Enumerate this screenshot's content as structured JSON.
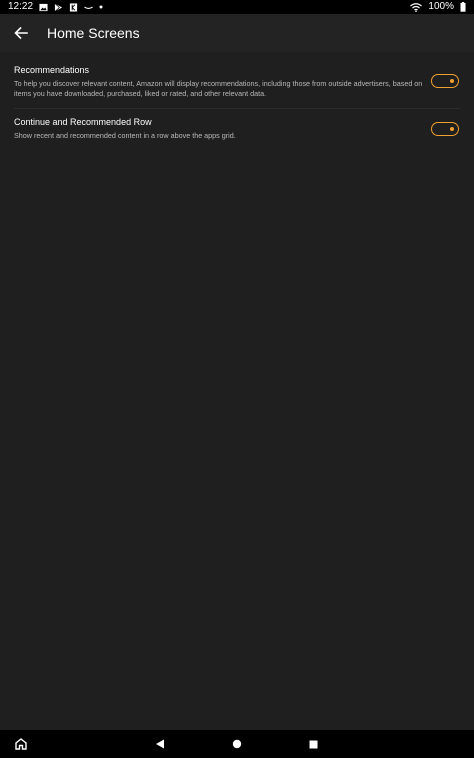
{
  "status_bar": {
    "time": "12:22",
    "battery": "100%",
    "icons_left": [
      "image-icon",
      "play-store-icon",
      "kindle-icon",
      "amazon-smile-icon",
      "dot-icon"
    ],
    "icons_right": [
      "wifi-icon",
      "battery-icon"
    ]
  },
  "app_bar": {
    "title": "Home Screens",
    "back_icon": "back-arrow-icon"
  },
  "settings": [
    {
      "title": "Recommendations",
      "description": "To help you discover relevant content, Amazon will display recommendations, including those from outside advertisers, based on items you have downloaded, purchased, liked or rated, and other relevant data.",
      "toggle_on": true
    },
    {
      "title": "Continue and Recommended Row",
      "description": "Show recent and recommended content in a row above the apps grid.",
      "toggle_on": true
    }
  ],
  "nav_bar": {
    "buttons": [
      "home-icon",
      "back-triangle-icon",
      "home-circle-icon",
      "recents-square-icon"
    ]
  },
  "colors": {
    "background": "#1f1f1f",
    "app_bar": "#232323",
    "accent": "#f0a030",
    "text_primary": "#ffffff",
    "text_secondary": "#b9b9b9"
  }
}
